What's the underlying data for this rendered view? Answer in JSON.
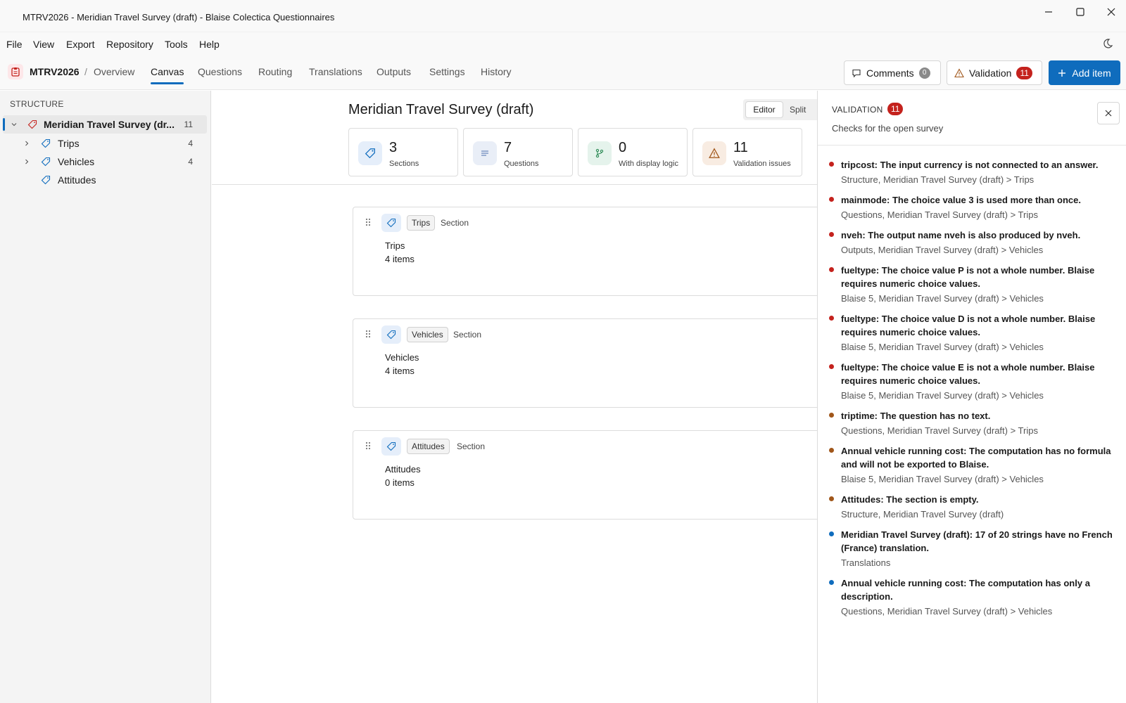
{
  "window": {
    "title": "MTRV2026 - Meridian Travel Survey (draft) - Blaise Colectica Questionnaires"
  },
  "menu": [
    "File",
    "View",
    "Export",
    "Repository",
    "Tools",
    "Help"
  ],
  "header": {
    "project_code": "MTRV2026",
    "separator": "/",
    "overview": "Overview",
    "tabs": [
      "Canvas",
      "Questions",
      "Routing",
      "Translations",
      "Outputs",
      "Settings",
      "History"
    ],
    "active_tab": "Canvas",
    "comments_label": "Comments",
    "comments_count": "0",
    "validation_label": "Validation",
    "validation_count": "11",
    "add_item_label": "Add item"
  },
  "sidebar": {
    "heading": "STRUCTURE",
    "root": {
      "label": "Meridian Travel Survey (dr...",
      "count": "11"
    },
    "items": [
      {
        "label": "Trips",
        "count": "4"
      },
      {
        "label": "Vehicles",
        "count": "4"
      },
      {
        "label": "Attitudes",
        "count": ""
      }
    ]
  },
  "main": {
    "title": "Meridian Travel Survey (draft)",
    "mode_editor": "Editor",
    "mode_split": "Split",
    "stats": [
      {
        "value": "3",
        "label": "Sections",
        "icon": "tag-icon"
      },
      {
        "value": "7",
        "label": "Questions",
        "icon": "lines-icon"
      },
      {
        "value": "0",
        "label": "With display logic",
        "icon": "branch-icon"
      },
      {
        "value": "11",
        "label": "Validation issues",
        "icon": "warning-icon"
      }
    ],
    "sections": [
      {
        "chip": "Trips",
        "kind": "Section",
        "name": "Trips",
        "items": "4  items"
      },
      {
        "chip": "Vehicles",
        "kind": "Section",
        "name": "Vehicles",
        "items": "4  items"
      },
      {
        "chip": "Attitudes",
        "kind": "Section",
        "name": "Attitudes",
        "items": "0  items"
      }
    ]
  },
  "validation": {
    "heading": "VALIDATION",
    "count": "11",
    "subtitle": "Checks for the open survey",
    "colors": {
      "error": "#c4221d",
      "warning": "#a0561a",
      "info": "#0f6cbd"
    },
    "issues": [
      {
        "severity": "error",
        "message": "tripcost: The input currency is not connected to an answer.",
        "path": "Structure, Meridian Travel Survey (draft) > Trips"
      },
      {
        "severity": "error",
        "message": "mainmode: The choice value 3 is used more than once.",
        "path": "Questions, Meridian Travel Survey (draft) > Trips"
      },
      {
        "severity": "error",
        "message": "nveh: The output name nveh is also produced by nveh.",
        "path": "Outputs, Meridian Travel Survey (draft) > Vehicles"
      },
      {
        "severity": "error",
        "message": "fueltype: The choice value P is not a whole number. Blaise requires numeric choice values.",
        "path": "Blaise 5, Meridian Travel Survey (draft) > Vehicles"
      },
      {
        "severity": "error",
        "message": "fueltype: The choice value D is not a whole number. Blaise requires numeric choice values.",
        "path": "Blaise 5, Meridian Travel Survey (draft) > Vehicles"
      },
      {
        "severity": "error",
        "message": "fueltype: The choice value E is not a whole number. Blaise requires numeric choice values.",
        "path": "Blaise 5, Meridian Travel Survey (draft) > Vehicles"
      },
      {
        "severity": "warning",
        "message": "triptime: The question has no text.",
        "path": "Questions, Meridian Travel Survey (draft) > Trips"
      },
      {
        "severity": "warning",
        "message": "Annual vehicle running cost: The computation has no formula and will not be exported to Blaise.",
        "path": "Blaise 5, Meridian Travel Survey (draft) > Vehicles"
      },
      {
        "severity": "warning",
        "message": "Attitudes: The section is empty.",
        "path": "Structure, Meridian Travel Survey (draft)"
      },
      {
        "severity": "info",
        "message": "Meridian Travel Survey (draft): 17 of 20 strings have no French (France) translation.",
        "path": "Translations"
      },
      {
        "severity": "info",
        "message": "Annual vehicle running cost: The computation has only a description.",
        "path": "Questions, Meridian Travel Survey (draft) > Vehicles"
      }
    ]
  }
}
